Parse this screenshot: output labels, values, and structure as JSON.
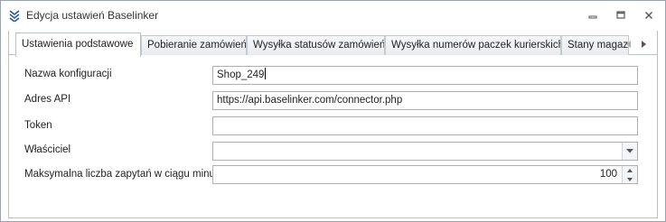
{
  "window": {
    "title": "Edycja ustawień Baselinker",
    "app_icon": "stacked-chevrons-icon",
    "controls": {
      "minimize": "minimize-icon",
      "maximize": "maximize-icon",
      "close": "close-icon"
    }
  },
  "tabs": [
    {
      "label": "Ustawienia podstawowe",
      "active": true
    },
    {
      "label": "Pobieranie zamówień",
      "active": false
    },
    {
      "label": "Wysyłka statusów zamówień",
      "active": false
    },
    {
      "label": "Wysyłka numerów paczek kurierskich",
      "active": false
    },
    {
      "label": "Stany magazy",
      "active": false
    }
  ],
  "form": {
    "config_name": {
      "label": "Nazwa konfiguracji",
      "value": "Shop_249"
    },
    "api_address": {
      "label": "Adres API",
      "value": "https://api.baselinker.com/connector.php"
    },
    "token": {
      "label": "Token",
      "value": ""
    },
    "owner": {
      "label": "Właściciel",
      "value": ""
    },
    "max_requests": {
      "label": "Maksymalna liczba zapytań w ciągu minuty",
      "value": "100"
    }
  },
  "colors": {
    "accent": "#2b5797",
    "border": "#b9c0c8"
  }
}
